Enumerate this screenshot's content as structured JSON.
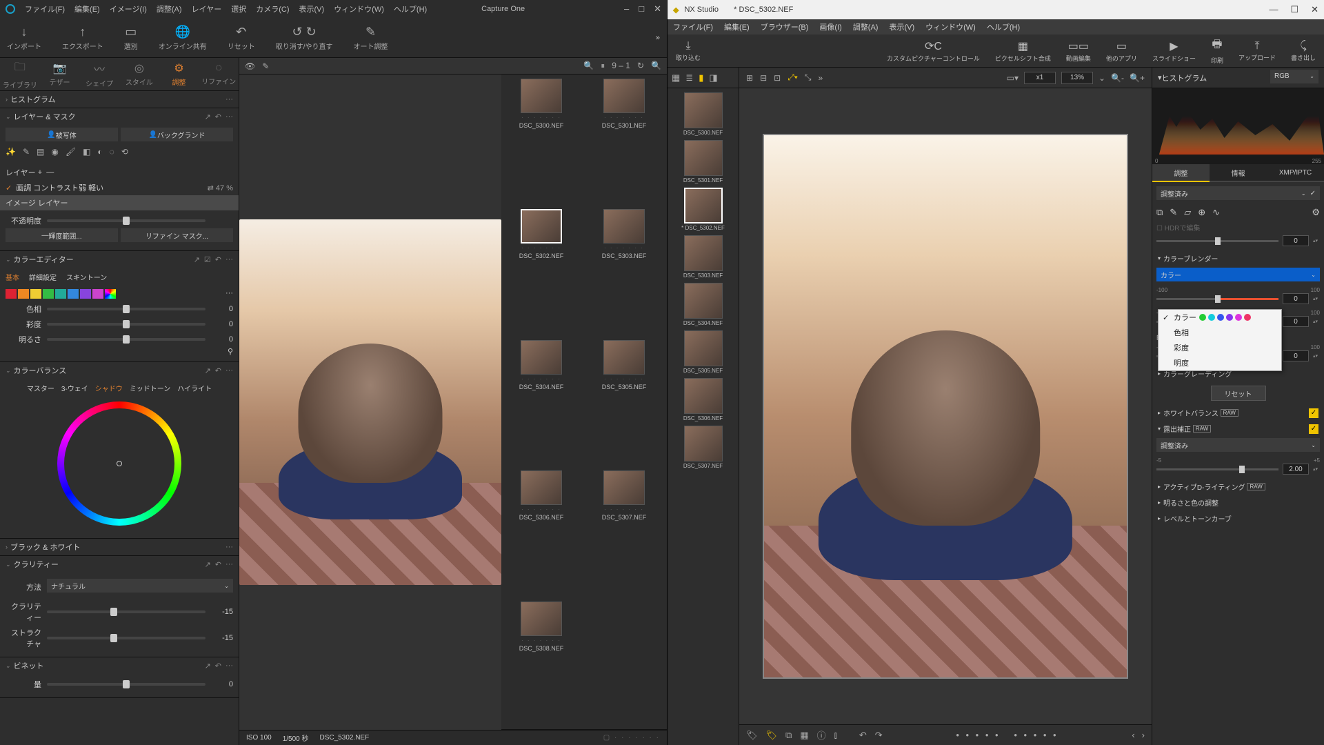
{
  "capture_one": {
    "app_name": "Capture One",
    "menus": [
      "ファイル(F)",
      "編集(E)",
      "イメージ(I)",
      "調整(A)",
      "レイヤー",
      "選択",
      "カメラ(C)",
      "表示(V)",
      "ウィンドウ(W)",
      "ヘルプ(H)"
    ],
    "toolbar": [
      {
        "icn": "↓",
        "label": "インポート"
      },
      {
        "icn": "↑",
        "label": "エクスポート"
      },
      {
        "icn": "▭",
        "label": "選別"
      },
      {
        "icn": "🌐",
        "label": "オンライン共有"
      },
      {
        "icn": "↶",
        "label": "リセット"
      },
      {
        "icn": "↺ ↻",
        "label": "取り消す/やり直す"
      },
      {
        "icn": "✎",
        "label": "オート調整"
      }
    ],
    "tabs": [
      {
        "icn": "🗀",
        "label": "ライブラリ"
      },
      {
        "icn": "📷",
        "label": "テザー"
      },
      {
        "icn": "〰",
        "label": "シェイプ"
      },
      {
        "icn": "◎",
        "label": "スタイル"
      },
      {
        "icn": "⚙",
        "label": "調整"
      },
      {
        "icn": "◌",
        "label": "リファイン"
      }
    ],
    "active_tab": "調整",
    "histogram": "ヒストグラム",
    "layers_masks": {
      "title": "レイヤー & マスク",
      "subject": "被写体",
      "background": "バックグランド"
    },
    "layer_label": "レイヤー",
    "layers": [
      {
        "name": "画調 コントラスト弱 軽い",
        "opacity": "47 %",
        "checked": true
      },
      {
        "name": "イメージ レイヤー",
        "selected": true
      }
    ],
    "opacity_label": "不透明度",
    "luminance_range": "輝度範囲...",
    "refine_mask": "リファイン マスク...",
    "color_editor": {
      "title": "カラーエディター",
      "tabs": [
        "基本",
        "詳細設定",
        "スキントーン"
      ],
      "active": "基本"
    },
    "swatches": [
      "#d23",
      "#e82",
      "#ec3",
      "#3b4",
      "#2a9",
      "#38d",
      "#84d",
      "#c4c",
      "#fff"
    ],
    "ce_rows": [
      {
        "label": "色相",
        "val": "0",
        "pos": 50
      },
      {
        "label": "彩度",
        "val": "0",
        "pos": 50
      },
      {
        "label": "明るさ",
        "val": "0",
        "pos": 50
      }
    ],
    "color_balance": {
      "title": "カラーバランス",
      "tabs": [
        "マスター",
        "3-ウェイ",
        "シャドウ",
        "ミッドトーン",
        "ハイライト"
      ],
      "active": "シャドウ"
    },
    "bw": "ブラック & ホワイト",
    "clarity": {
      "title": "クラリティー",
      "method_label": "方法",
      "method": "ナチュラル",
      "rows": [
        {
          "label": "クラリティー",
          "val": "-15",
          "pos": 42
        },
        {
          "label": "ストラクチャ",
          "val": "-15",
          "pos": 42
        }
      ]
    },
    "vignette": {
      "title": "ビネット",
      "row": {
        "label": "量",
        "val": "0",
        "pos": 50
      }
    },
    "view_count": "9 – 1",
    "thumbs": [
      "DSC_5300.NEF",
      "DSC_5301.NEF",
      "DSC_5302.NEF",
      "DSC_5303.NEF",
      "DSC_5304.NEF",
      "DSC_5305.NEF",
      "DSC_5306.NEF",
      "DSC_5307.NEF",
      "DSC_5308.NEF"
    ],
    "selected_thumb": "DSC_5302.NEF",
    "status": {
      "iso": "ISO 100",
      "shutter": "1/500 秒",
      "file": "DSC_5302.NEF"
    }
  },
  "nx": {
    "app_name": "NX Studio",
    "doc_name": "* DSC_5302.NEF",
    "menus": [
      "ファイル(F)",
      "編集(E)",
      "ブラウザー(B)",
      "画像(I)",
      "調整(A)",
      "表示(V)",
      "ウィンドウ(W)",
      "ヘルプ(H)"
    ],
    "toolbar": [
      {
        "icn": "⤓",
        "label": "取り込む"
      },
      {
        "icn": "⟳C",
        "label": "カスタムピクチャーコントロール"
      },
      {
        "icn": "▦",
        "label": "ピクセルシフト合成"
      },
      {
        "icn": "▭▭",
        "label": "動画編集"
      },
      {
        "icn": "▭",
        "label": "他のアプリ"
      },
      {
        "icn": "▶",
        "label": "スライドショー"
      },
      {
        "icn": "🖶",
        "label": "印刷"
      },
      {
        "icn": "⤒",
        "label": "アップロード"
      },
      {
        "icn": "⤹",
        "label": "書き出し"
      }
    ],
    "zoom_mode": "x1",
    "zoom_pct": "13%",
    "thumbs": [
      "DSC_5300.NEF",
      "DSC_5301.NEF",
      "* DSC_5302.NEF",
      "DSC_5303.NEF",
      "DSC_5304.NEF",
      "DSC_5305.NEF",
      "DSC_5306.NEF",
      "DSC_5307.NEF"
    ],
    "selected_thumb": "* DSC_5302.NEF",
    "histogram_label": "ヒストグラム",
    "histogram_mode": "RGB",
    "histogram_axis": [
      "0",
      "255"
    ],
    "tabs": [
      "調整",
      "情報",
      "XMP/IPTC"
    ],
    "active_tab": "調整",
    "adj_preset": "調整済み",
    "hdr_label": "HDRで編集",
    "slider_zero": "0",
    "color_blender": {
      "title": "カラーブレンダー",
      "dropdown": "カラー",
      "options": [
        "カラー",
        "色相",
        "彩度",
        "明度"
      ],
      "dots": [
        "#2c3",
        "#1cd",
        "#35e",
        "#83e",
        "#d3d",
        "#e36"
      ],
      "brightness_label": "明度",
      "range": [
        "-100",
        "100"
      ],
      "rows": [
        {
          "val": "0"
        },
        {
          "val": "0"
        },
        {
          "val": "0"
        }
      ]
    },
    "color_grading": "カラーグレーディング",
    "reset": "リセット",
    "white_balance": "ホワイトバランス",
    "exposure": {
      "title": "露出補正",
      "preset": "調整済み",
      "range": [
        "-5",
        "+5"
      ],
      "val": "2.00"
    },
    "active_d": "アクティブD-ライティング",
    "bright_color": "明るさと色の調整",
    "levels_curve": "レベルとトーンカーブ",
    "raw_tag": "RAW"
  }
}
